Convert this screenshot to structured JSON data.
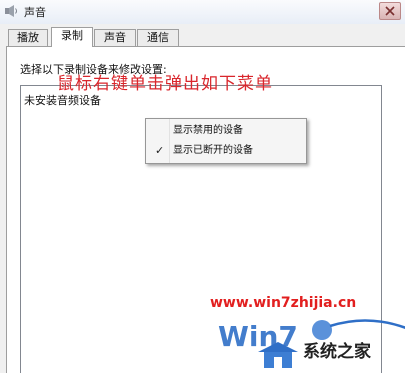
{
  "window": {
    "title": "声音",
    "icon": "speaker-icon",
    "close_icon": "close-icon"
  },
  "tabs": [
    {
      "label": "播放",
      "active": false
    },
    {
      "label": "录制",
      "active": true
    },
    {
      "label": "声音",
      "active": false
    },
    {
      "label": "通信",
      "active": false
    }
  ],
  "recording": {
    "instruction": "选择以下录制设备来修改设置:",
    "empty_message": "未安装音频设备"
  },
  "annotation": "鼠标右键单击弹出如下菜单",
  "context_menu": {
    "items": [
      {
        "label": "显示禁用的设备",
        "checked": false
      },
      {
        "label": "显示已断开的设备",
        "checked": true
      }
    ],
    "check_glyph": "✓"
  },
  "watermark": {
    "url": "www.win7zhijia.cn",
    "logo_text": "Win7",
    "brand": "系统之家",
    "colors": {
      "url": "#e21f1f",
      "logo": "#2f6fc7"
    }
  }
}
